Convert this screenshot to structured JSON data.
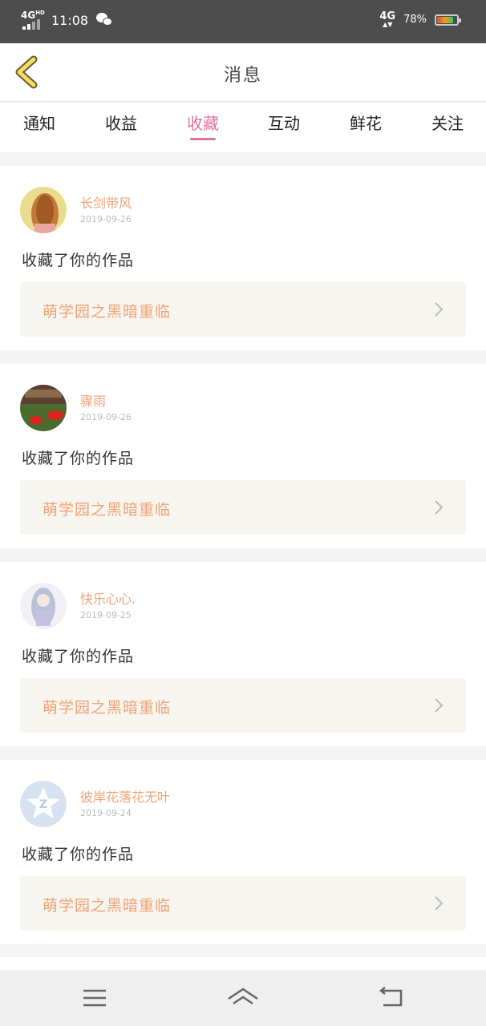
{
  "status_bar": {
    "network_left": "4G",
    "network_left_badge": "HD",
    "time": "11:08",
    "network_right": "4G",
    "battery": "78%",
    "battery_level": 0.78,
    "icons": [
      "signal-icon",
      "wechat-icon",
      "battery-icon"
    ]
  },
  "header": {
    "title": "消息",
    "back_icon": "back-chevron-icon"
  },
  "tabs": [
    {
      "label": "通知",
      "active": false
    },
    {
      "label": "收益",
      "active": false
    },
    {
      "label": "收藏",
      "active": true
    },
    {
      "label": "互动",
      "active": false
    },
    {
      "label": "鲜花",
      "active": false
    },
    {
      "label": "关注",
      "active": false
    }
  ],
  "colors": {
    "accent": "#e0729d",
    "name": "#f1a277",
    "work_bg": "#f6f5ef"
  },
  "messages": [
    {
      "username": "长剑带风",
      "date": "2019-09-26",
      "action": "收藏了你的作品",
      "work_title": "萌学园之黑暗重临"
    },
    {
      "username": "骤雨",
      "date": "2019-09-26",
      "action": "收藏了你的作品",
      "work_title": "萌学园之黑暗重临"
    },
    {
      "username": "快乐心心.",
      "date": "2019-09-25",
      "action": "收藏了你的作品",
      "work_title": "萌学园之黑暗重临"
    },
    {
      "username": "彼岸花落花无叶",
      "date": "2019-09-24",
      "action": "收藏了你的作品",
      "work_title": "萌学园之黑暗重临"
    }
  ],
  "nav": {
    "icons": [
      "menu-icon",
      "home-icon",
      "back-icon"
    ]
  }
}
